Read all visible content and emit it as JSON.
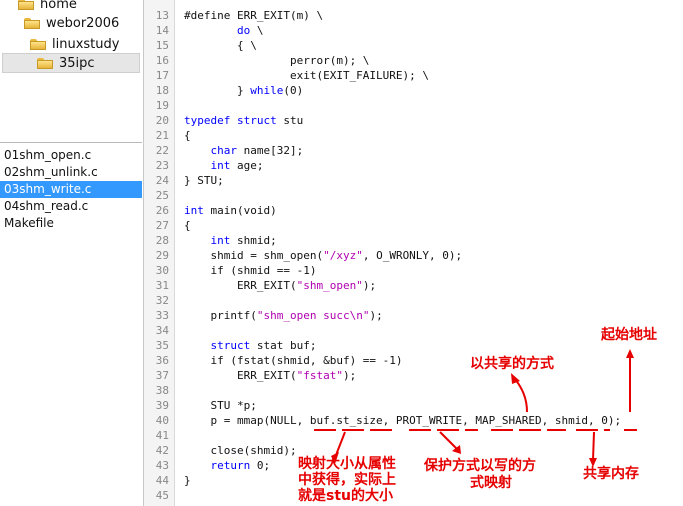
{
  "tree": {
    "items": [
      {
        "label": "home"
      },
      {
        "label": "webor2006"
      },
      {
        "label": "linuxstudy"
      },
      {
        "label": "35ipc"
      }
    ]
  },
  "files": {
    "items": [
      {
        "label": "01shm_open.c"
      },
      {
        "label": "02shm_unlink.c"
      },
      {
        "label": "03shm_write.c"
      },
      {
        "label": "04shm_read.c"
      },
      {
        "label": "Makefile"
      }
    ]
  },
  "editor": {
    "lines": [
      {
        "n": "13",
        "t": "#define ERR_EXIT(m) \\"
      },
      {
        "n": "14",
        "t": "        do \\"
      },
      {
        "n": "15",
        "t": "        { \\"
      },
      {
        "n": "16",
        "t": "                perror(m); \\"
      },
      {
        "n": "17",
        "t": "                exit(EXIT_FAILURE); \\"
      },
      {
        "n": "18",
        "t": "        } while(0)"
      },
      {
        "n": "19",
        "t": ""
      },
      {
        "n": "20",
        "t": "typedef struct stu"
      },
      {
        "n": "21",
        "t": "{"
      },
      {
        "n": "22",
        "t": "    char name[32];"
      },
      {
        "n": "23",
        "t": "    int age;"
      },
      {
        "n": "24",
        "t": "} STU;"
      },
      {
        "n": "25",
        "t": ""
      },
      {
        "n": "26",
        "t": "int main(void)"
      },
      {
        "n": "27",
        "t": "{"
      },
      {
        "n": "28",
        "t": "    int shmid;"
      },
      {
        "n": "29",
        "t": "    shmid = shm_open(\"/xyz\", O_WRONLY, 0);"
      },
      {
        "n": "30",
        "t": "    if (shmid == -1)"
      },
      {
        "n": "31",
        "t": "        ERR_EXIT(\"shm_open\");"
      },
      {
        "n": "32",
        "t": ""
      },
      {
        "n": "33",
        "t": "    printf(\"shm_open succ\\n\");"
      },
      {
        "n": "34",
        "t": ""
      },
      {
        "n": "35",
        "t": "    struct stat buf;"
      },
      {
        "n": "36",
        "t": "    if (fstat(shmid, &buf) == -1)"
      },
      {
        "n": "37",
        "t": "        ERR_EXIT(\"fstat\");"
      },
      {
        "n": "38",
        "t": ""
      },
      {
        "n": "39",
        "t": "    STU *p;"
      },
      {
        "n": "40",
        "t": "    p = mmap(NULL, buf.st_size, PROT_WRITE, MAP_SHARED, shmid, 0);"
      },
      {
        "n": "41",
        "t": ""
      },
      {
        "n": "42",
        "t": "    close(shmid);"
      },
      {
        "n": "43",
        "t": "    return 0;"
      },
      {
        "n": "44",
        "t": "}"
      },
      {
        "n": "45",
        "t": ""
      }
    ]
  },
  "annotations": {
    "start_addr": "起始地址",
    "shared_mode": "以共享的方式",
    "size_line1": "映射大小从属性",
    "size_line2": "中获得，实际上",
    "size_line3": "就是stu的大小",
    "prot_line1": "保护方式以写的方",
    "prot_line2": "式映射",
    "shm": "共享内存"
  },
  "colors": {
    "annotation": "#e60000",
    "selection": "#3399ff",
    "keyword": "#0000ff"
  }
}
